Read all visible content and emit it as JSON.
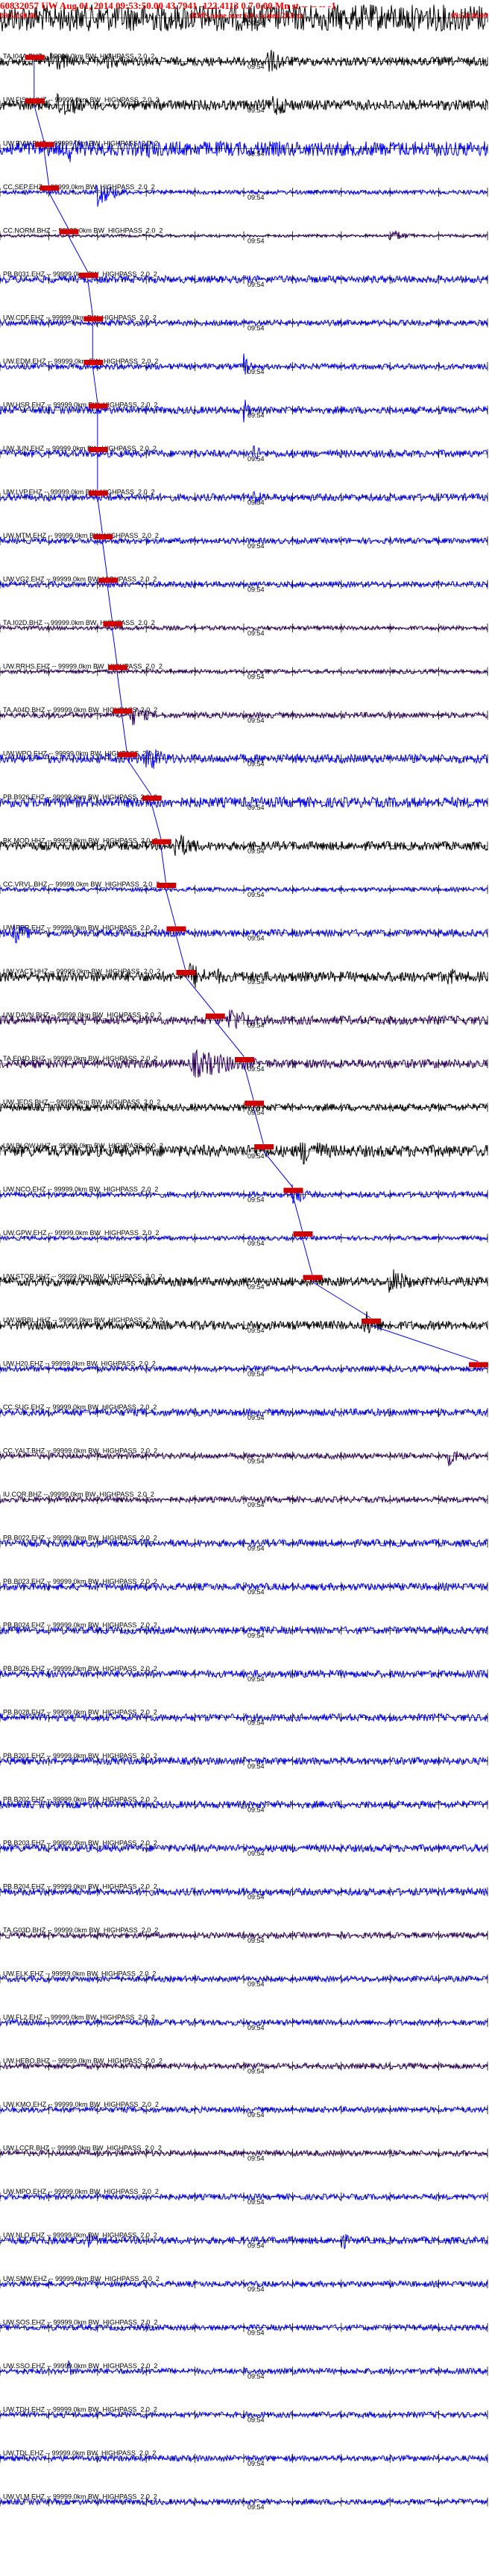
{
  "header": {
    "title": "60832057 UW Aug 01, 2014 09:53:50.00   43.7941 -122.4113  0.7 0.00 Mn st -- -- -- -1",
    "start_time": "09:53:00.00",
    "note": "(RMS noise over 6.0 s scaled 20.0 x)",
    "end_time": "09:54:40.00"
  },
  "colors": {
    "header": "#ff0000",
    "trace_blue": "#0000ff",
    "trace_black": "#000000",
    "trace_purple": "#330066",
    "pick": "#cc0000"
  },
  "chart_data": {
    "type": "seismogram",
    "time_window": [
      "09:53:00",
      "09:54:40"
    ],
    "minute_tick_label": "09:54",
    "trace_label_suffix": "-- 99999.0km BW_HIGHPASS_2.0_2",
    "traces": [
      {
        "station": "",
        "color": "black",
        "amp": 0.9,
        "events": [
          [
            0.06,
            1.0,
            0.06
          ],
          [
            0.3,
            0.6,
            0.05
          ],
          [
            0.55,
            0.9,
            0.08
          ],
          [
            0.85,
            1.0,
            0.05
          ]
        ],
        "pick": null
      },
      {
        "station": "TA.I04A.BHZ",
        "color": "black",
        "amp": 0.3,
        "events": [
          [
            0.1,
            1.0,
            0.04
          ],
          [
            0.22,
            0.6,
            0.05
          ],
          [
            0.55,
            0.9,
            0.04
          ]
        ],
        "pick": 0.07
      },
      {
        "station": "UW.FISH.HHZ",
        "color": "black",
        "amp": 0.35,
        "events": [
          [
            0.12,
            1.0,
            0.05
          ],
          [
            0.56,
            0.9,
            0.04
          ]
        ],
        "pick": 0.07
      },
      {
        "station": "UW.BVW.BHZ",
        "color": "blue",
        "amp": 0.5,
        "events": [
          [
            0.14,
            1.0,
            0.04
          ],
          [
            0.3,
            0.8,
            0.04
          ]
        ],
        "pick": 0.09
      },
      {
        "station": "CC.SEP.EHZ",
        "color": "blue",
        "amp": 0.15,
        "events": [
          [
            0.2,
            1.0,
            0.03
          ]
        ],
        "pick": 0.1
      },
      {
        "station": "CC.NORM.BHZ",
        "color": "purple",
        "amp": 0.1,
        "events": [
          [
            0.8,
            0.5,
            0.03
          ]
        ],
        "pick": 0.14
      },
      {
        "station": "PB.B031.EHZ",
        "color": "blue",
        "amp": 0.25,
        "events": [],
        "pick": 0.18
      },
      {
        "station": "UW.CDF.EHZ",
        "color": "blue",
        "amp": 0.2,
        "events": [],
        "pick": 0.19
      },
      {
        "station": "UW.EDM.EHZ",
        "color": "blue",
        "amp": 0.2,
        "events": [
          [
            0.5,
            1.0,
            0.01
          ]
        ],
        "pick": 0.19
      },
      {
        "station": "UW.HSR.EHZ",
        "color": "blue",
        "amp": 0.25,
        "events": [
          [
            0.5,
            1.0,
            0.01
          ]
        ],
        "pick": 0.2
      },
      {
        "station": "UW.JUN.EHZ",
        "color": "blue",
        "amp": 0.25,
        "events": [
          [
            0.52,
            1.0,
            0.01
          ]
        ],
        "pick": 0.2
      },
      {
        "station": "UW.LVP.EHZ",
        "color": "blue",
        "amp": 0.25,
        "events": [
          [
            0.52,
            1.0,
            0.01
          ]
        ],
        "pick": 0.2
      },
      {
        "station": "UW.MTM.EHZ",
        "color": "blue",
        "amp": 0.2,
        "events": [],
        "pick": 0.21
      },
      {
        "station": "UW.VG2.EHZ",
        "color": "blue",
        "amp": 0.2,
        "events": [],
        "pick": 0.22
      },
      {
        "station": "TA.I02D.BHZ",
        "color": "purple",
        "amp": 0.15,
        "events": [],
        "pick": 0.23
      },
      {
        "station": "UW.RRHS.EHZ",
        "color": "purple",
        "amp": 0.15,
        "events": [],
        "pick": 0.24
      },
      {
        "station": "TA.A04D.BHZ",
        "color": "purple",
        "amp": 0.2,
        "events": [
          [
            0.27,
            0.8,
            0.03
          ]
        ],
        "pick": 0.25
      },
      {
        "station": "UW.WPO.EHZ",
        "color": "blue",
        "amp": 0.3,
        "events": [
          [
            0.3,
            1.0,
            0.04
          ]
        ],
        "pick": 0.26
      },
      {
        "station": "PB.B926.EHZ",
        "color": "blue",
        "amp": 0.35,
        "events": [],
        "pick": 0.31
      },
      {
        "station": "BK.MOD.HHZ",
        "color": "black",
        "amp": 0.3,
        "events": [
          [
            0.36,
            1.0,
            0.04
          ]
        ],
        "pick": 0.33
      },
      {
        "station": "CC.VRVL.BHZ",
        "color": "blue",
        "amp": 0.15,
        "events": [],
        "pick": 0.34
      },
      {
        "station": "UW.PER.EHZ",
        "color": "blue",
        "amp": 0.25,
        "events": [
          [
            0.03,
            0.8,
            0.03
          ]
        ],
        "pick": 0.36
      },
      {
        "station": "UW.YACT.HHZ",
        "color": "black",
        "amp": 0.35,
        "events": [
          [
            0.39,
            1.0,
            0.04
          ],
          [
            0.44,
            0.7,
            0.03
          ],
          [
            0.92,
            0.8,
            0.02
          ]
        ],
        "pick": 0.38
      },
      {
        "station": "UW.DAVN.BHZ",
        "color": "purple",
        "amp": 0.3,
        "events": [
          [
            0.47,
            1.0,
            0.04
          ]
        ],
        "pick": 0.44
      },
      {
        "station": "TA.E04D.BHZ",
        "color": "purple",
        "amp": 0.3,
        "events": [
          [
            0.4,
            1.0,
            0.1
          ]
        ],
        "pick": 0.5
      },
      {
        "station": "UW.JEDS.BHZ",
        "color": "black",
        "amp": 0.25,
        "events": [],
        "pick": 0.52
      },
      {
        "station": "UW.BLOW.HHZ",
        "color": "black",
        "amp": 0.4,
        "events": [
          [
            0.62,
            1.0,
            0.06
          ]
        ],
        "pick": 0.54
      },
      {
        "station": "UW.NCO.EHZ",
        "color": "blue",
        "amp": 0.2,
        "events": [
          [
            0.6,
            1.0,
            0.02
          ]
        ],
        "pick": 0.6
      },
      {
        "station": "UW.GPW.EHZ",
        "color": "blue",
        "amp": 0.15,
        "events": [],
        "pick": 0.62
      },
      {
        "station": "UW.STOR.HHZ",
        "color": "black",
        "amp": 0.3,
        "events": [
          [
            0.8,
            1.0,
            0.04
          ]
        ],
        "pick": 0.64
      },
      {
        "station": "UW.WRBL.HHZ",
        "color": "black",
        "amp": 0.3,
        "events": [
          [
            0.75,
            1.0,
            0.03
          ]
        ],
        "pick": 0.76
      },
      {
        "station": "UW.H20.EHZ",
        "color": "blue",
        "amp": 0.2,
        "events": [],
        "pick": 0.98
      },
      {
        "station": "CC.SUG.EHZ",
        "color": "blue",
        "amp": 0.25,
        "events": [],
        "pick": null
      },
      {
        "station": "CC.YALT.BHZ",
        "color": "purple",
        "amp": 0.2,
        "events": [
          [
            0.92,
            0.7,
            0.03
          ]
        ],
        "pick": null
      },
      {
        "station": "IU.COR.BHZ",
        "color": "purple",
        "amp": 0.2,
        "events": [],
        "pick": null
      },
      {
        "station": "PB.B022.EHZ",
        "color": "blue",
        "amp": 0.25,
        "events": [],
        "pick": null
      },
      {
        "station": "PB.B023.EHZ",
        "color": "blue",
        "amp": 0.25,
        "events": [],
        "pick": null
      },
      {
        "station": "PB.B024.EHZ",
        "color": "blue",
        "amp": 0.25,
        "events": [],
        "pick": null
      },
      {
        "station": "PB.B026.EHZ",
        "color": "blue",
        "amp": 0.25,
        "events": [],
        "pick": null
      },
      {
        "station": "PB.B028.EHZ",
        "color": "blue",
        "amp": 0.25,
        "events": [],
        "pick": null
      },
      {
        "station": "PB.B201.EHZ",
        "color": "blue",
        "amp": 0.25,
        "events": [],
        "pick": null
      },
      {
        "station": "PB.B202.EHZ",
        "color": "blue",
        "amp": 0.25,
        "events": [],
        "pick": null
      },
      {
        "station": "PB.B203.EHZ",
        "color": "blue",
        "amp": 0.25,
        "events": [],
        "pick": null
      },
      {
        "station": "PB.B204.EHZ",
        "color": "blue",
        "amp": 0.25,
        "events": [],
        "pick": null
      },
      {
        "station": "TA.G03D.BHZ",
        "color": "purple",
        "amp": 0.2,
        "events": [],
        "pick": null
      },
      {
        "station": "UW.ELK.EHZ",
        "color": "blue",
        "amp": 0.2,
        "events": [],
        "pick": null
      },
      {
        "station": "UW.FL2.EHZ",
        "color": "blue",
        "amp": 0.2,
        "events": [],
        "pick": null
      },
      {
        "station": "UW.HEBO.BHZ",
        "color": "purple",
        "amp": 0.2,
        "events": [],
        "pick": null
      },
      {
        "station": "UW.KMO.EHZ",
        "color": "blue",
        "amp": 0.2,
        "events": [],
        "pick": null
      },
      {
        "station": "UW.LCCR.BHZ",
        "color": "purple",
        "amp": 0.2,
        "events": [],
        "pick": null
      },
      {
        "station": "UW.MPO.EHZ",
        "color": "blue",
        "amp": 0.2,
        "events": [],
        "pick": null
      },
      {
        "station": "UW.NLO.EHZ",
        "color": "blue",
        "amp": 0.25,
        "events": [
          [
            0.18,
            0.8,
            0.01
          ],
          [
            0.7,
            1.0,
            0.01
          ]
        ],
        "pick": null
      },
      {
        "station": "UW.SMW.EHZ",
        "color": "blue",
        "amp": 0.2,
        "events": [],
        "pick": null
      },
      {
        "station": "UW.SOS.EHZ",
        "color": "blue",
        "amp": 0.2,
        "events": [],
        "pick": null
      },
      {
        "station": "UW.SSO.EHZ",
        "color": "blue",
        "amp": 0.2,
        "events": [
          [
            0.14,
            1.0,
            0.005
          ]
        ],
        "pick": null
      },
      {
        "station": "UW.TDH.EHZ",
        "color": "blue",
        "amp": 0.2,
        "events": [],
        "pick": null
      },
      {
        "station": "UW.TDL.EHZ",
        "color": "blue",
        "amp": 0.2,
        "events": [],
        "pick": null
      },
      {
        "station": "UW.VLM.EHZ",
        "color": "blue",
        "amp": 0.2,
        "events": [],
        "pick": null
      }
    ]
  }
}
